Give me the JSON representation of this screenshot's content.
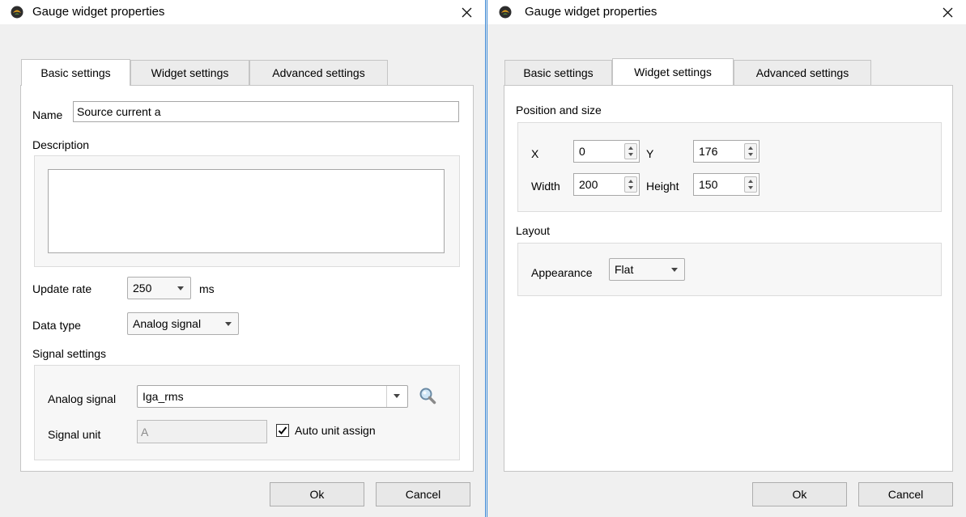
{
  "left": {
    "title": "Gauge widget properties",
    "tabs": [
      "Basic settings",
      "Widget settings",
      "Advanced settings"
    ],
    "name_label": "Name",
    "name_value": "Source current a",
    "description_label": "Description",
    "description_value": "",
    "update_rate_label": "Update rate",
    "update_rate_value": "250",
    "update_rate_unit": "ms",
    "data_type_label": "Data type",
    "data_type_value": "Analog signal",
    "signal_settings_label": "Signal settings",
    "analog_signal_label": "Analog signal",
    "analog_signal_value": "Iga_rms",
    "signal_unit_label": "Signal unit",
    "signal_unit_value": "A",
    "auto_unit_label": "Auto unit assign",
    "auto_unit_checked": true,
    "ok_label": "Ok",
    "cancel_label": "Cancel"
  },
  "right": {
    "title": "Gauge widget properties",
    "tabs": [
      "Basic settings",
      "Widget settings",
      "Advanced settings"
    ],
    "position_size_label": "Position and size",
    "x_label": "X",
    "x_value": "0",
    "y_label": "Y",
    "y_value": "176",
    "width_label": "Width",
    "width_value": "200",
    "height_label": "Height",
    "height_value": "150",
    "layout_label": "Layout",
    "appearance_label": "Appearance",
    "appearance_value": "Flat",
    "ok_label": "Ok",
    "cancel_label": "Cancel"
  },
  "icons": {
    "app": "app-icon",
    "close": "close-icon",
    "search": "search-icon",
    "check": "check-icon"
  }
}
